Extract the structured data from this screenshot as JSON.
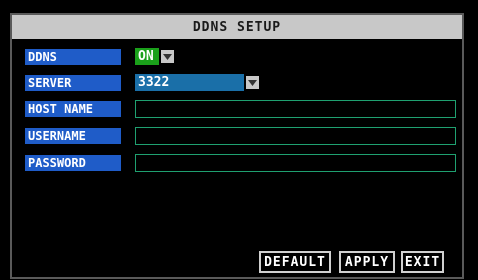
{
  "title": "DDNS SETUP",
  "rows": {
    "ddns": {
      "label": "DDNS",
      "value": "ON"
    },
    "server": {
      "label": "SERVER",
      "value": "3322"
    },
    "host_name": {
      "label": "HOST NAME",
      "value": ""
    },
    "username": {
      "label": "USERNAME",
      "value": ""
    },
    "password": {
      "label": "PASSWORD",
      "value": ""
    }
  },
  "buttons": {
    "default": "DEFAULT",
    "apply": "APPLY",
    "exit": "EXIT"
  },
  "colors": {
    "label_bg": "#1f5cc8",
    "on_bg": "#1aa01a",
    "server_bg": "#1a6fa8",
    "field_border": "#1fa070"
  }
}
